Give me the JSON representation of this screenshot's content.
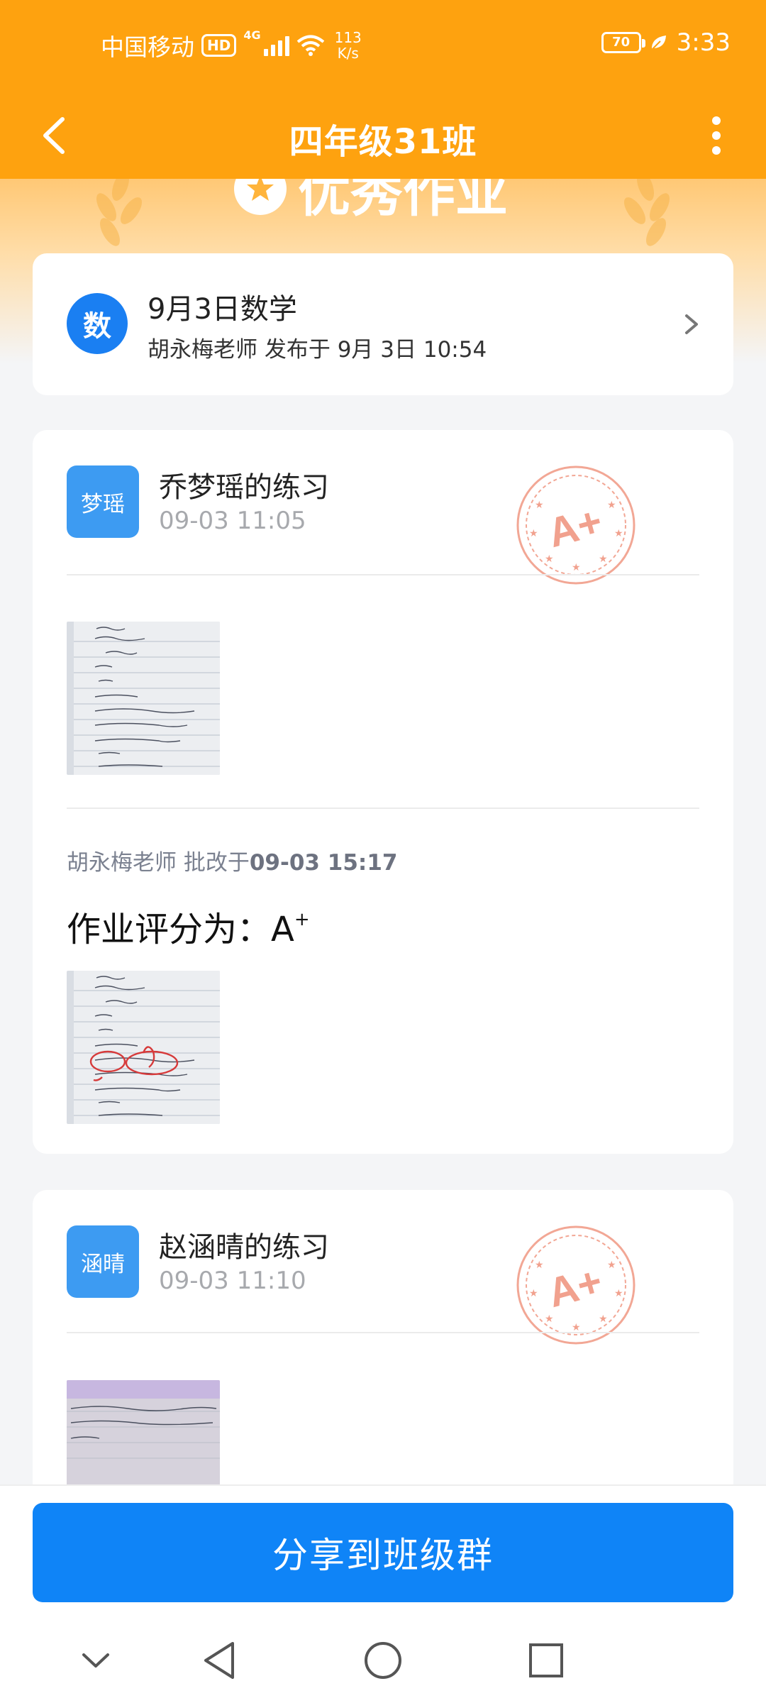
{
  "status_bar": {
    "carrier": "中国移动",
    "hd_badge": "HD",
    "network_type": "4G",
    "net_speed_value": "113",
    "net_speed_unit": "K/s",
    "battery_level": "70",
    "time": "3:33"
  },
  "nav": {
    "title": "四年级31班"
  },
  "hero": {
    "badge_text": "优秀作业"
  },
  "homework": {
    "subject_icon_text": "数",
    "title": "9月3日数学",
    "subtitle": "胡永梅老师 发布于 9月 3日 10:54"
  },
  "submissions": [
    {
      "avatar_text": "梦瑶",
      "title": "乔梦瑶的练习",
      "time": "09-03 11:05",
      "stamp_grade": "A+",
      "grader_prefix": "胡永梅老师 批改于",
      "graded_time": "09-03 15:17",
      "score_label": "作业评分为：",
      "score_value": "A",
      "score_sup": "+"
    },
    {
      "avatar_text": "涵晴",
      "title": "赵涵晴的练习",
      "time": "09-03 11:10",
      "stamp_grade": "A+"
    }
  ],
  "bottom": {
    "share_label": "分享到班级群"
  },
  "colors": {
    "brand_orange": "#fea20f",
    "primary_blue": "#0f84f7",
    "subject_blue": "#1a7ff2",
    "avatar_blue": "#3d9bf2",
    "stamp_red": "#ee8a72"
  },
  "icons": {
    "back": "chevron-left-icon",
    "more": "more-vertical-icon",
    "chevron": "chevron-right-icon",
    "stamp": "grade-stamp-icon",
    "nav_back": "triangle-back-icon",
    "nav_home": "circle-home-icon",
    "nav_recents": "square-recents-icon",
    "nav_collapse": "chevron-down-icon"
  }
}
